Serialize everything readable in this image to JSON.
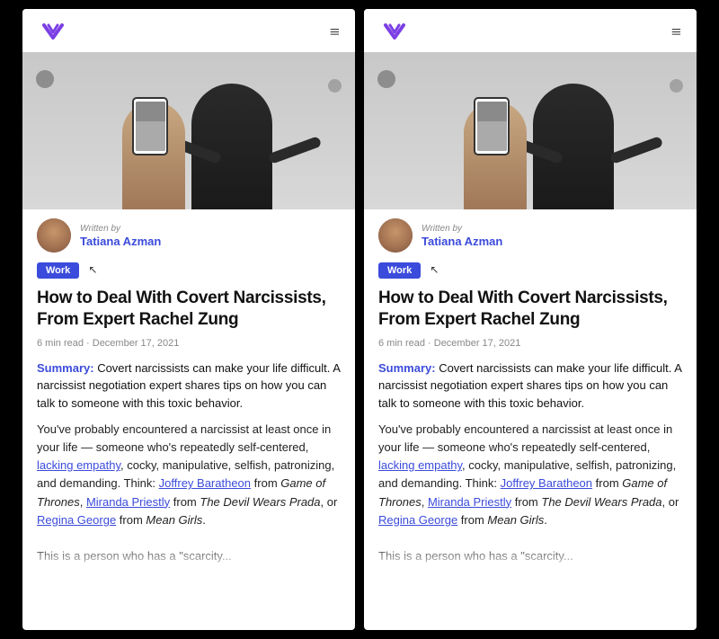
{
  "panels": [
    {
      "id": "panel-left",
      "header": {
        "logo_alt": "Wealthsimple logo",
        "menu_label": "≡"
      },
      "article": {
        "written_by_label": "Written by",
        "author_name": "Tatiana Azman",
        "tag": "Work",
        "title": "How to Deal With Covert Narcissists, From Expert Rachel Zung",
        "meta": "6 min read · December 17, 2021",
        "summary_label": "Summary:",
        "summary_text": " Covert narcissists can make your life difficult. A narcissist negotiation expert shares tips on how you can talk to someone with this toxic behavior.",
        "body1": "You've probably encountered a narcissist at least once in your life — someone who's repeatedly self-centered, ",
        "link1": "lacking empathy",
        "body2": ", cocky, manipulative, selfish, patronizing, and demanding. Think: ",
        "link2": "Joffrey Baratheon",
        "body3": " from ",
        "italic1": "Game of Thrones",
        "body4": ", ",
        "link3": "Miranda Priestly",
        "body5": " from ",
        "italic2": "The Devil Wears Prada",
        "body6": ", or ",
        "link4": "Regina George",
        "body7": " from ",
        "italic3": "Mean Girls",
        "body8": ".",
        "body9": "This is a person who has a \"scarcity..."
      }
    },
    {
      "id": "panel-right",
      "header": {
        "logo_alt": "Wealthsimple logo",
        "menu_label": "≡"
      },
      "article": {
        "written_by_label": "Written by",
        "author_name": "Tatiana Azman",
        "tag": "Work",
        "title": "How to Deal With Covert Narcissists, From Expert Rachel Zung",
        "meta": "6 min read · December 17, 2021",
        "summary_label": "Summary:",
        "summary_text": " Covert narcissists can make your life difficult. A narcissist negotiation expert shares tips on how you can talk to someone with this toxic behavior.",
        "body1": "You've probably encountered a narcissist at least once in your life — someone who's repeatedly self-centered, ",
        "link1": "lacking empathy",
        "body2": ", cocky, manipulative, selfish, patronizing, and demanding. Think: ",
        "link2": "Joffrey Baratheon",
        "body3": " from ",
        "italic1": "Game of Thrones",
        "body4": ", ",
        "link3": "Miranda Priestly",
        "body5": " from ",
        "italic2": "The Devil Wears Prada",
        "body6": ", or ",
        "link4": "Regina George",
        "body7": " from ",
        "italic3": "Mean Girls",
        "body8": ".",
        "body9": "This is a person who has a \"scarcity..."
      }
    }
  ],
  "colors": {
    "accent": "#3B4BDB",
    "text_primary": "#111111",
    "text_secondary": "#888888",
    "background": "#ffffff",
    "tag_bg": "#3B4BDB",
    "tag_text": "#ffffff"
  }
}
